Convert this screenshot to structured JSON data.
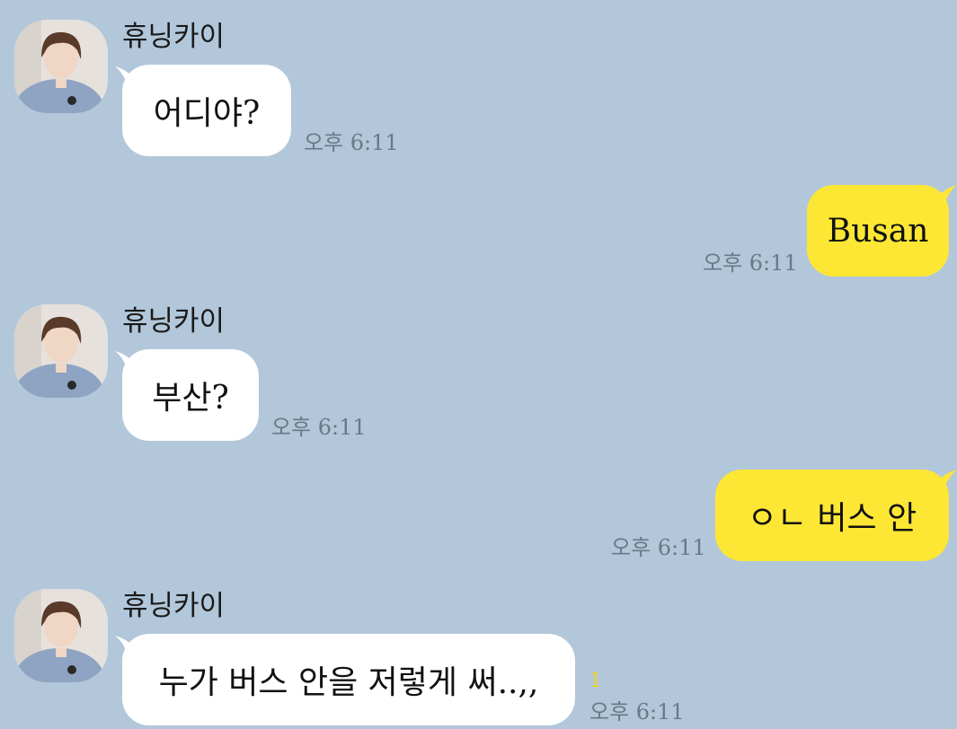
{
  "colors": {
    "background": "#b2c7da",
    "incoming_bubble": "#ffffff",
    "outgoing_bubble": "#fee734",
    "time_text": "#6b7886",
    "unread": "#f2d11b"
  },
  "messages": [
    {
      "sender": "휴닝카이",
      "text": "어디야?",
      "time": "오후 6:11",
      "direction": "in"
    },
    {
      "text": "Busan",
      "time": "오후 6:11",
      "direction": "out"
    },
    {
      "sender": "휴닝카이",
      "text": "부산?",
      "time": "오후 6:11",
      "direction": "in"
    },
    {
      "text": "ㅇㄴ 버스 안",
      "time": "오후 6:11",
      "direction": "out"
    },
    {
      "sender": "휴닝카이",
      "text": "누가 버스 안을 저렇게 써..,,",
      "time": "오후 6:11",
      "direction": "in",
      "unread": "1"
    }
  ],
  "avatar_icon": "profile-photo"
}
